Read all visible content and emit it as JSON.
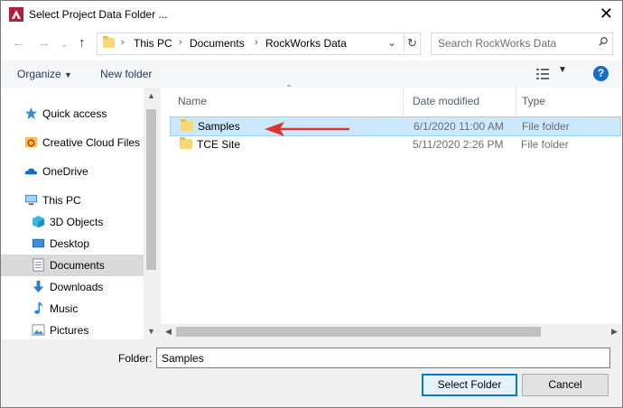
{
  "window": {
    "title": "Select Project Data Folder ..."
  },
  "address": {
    "crumbs": [
      "This PC",
      "Documents",
      "RockWorks Data"
    ],
    "search_placeholder": "Search RockWorks Data"
  },
  "toolbar": {
    "organize_label": "Organize",
    "new_folder_label": "New folder"
  },
  "sidebar": {
    "items": [
      {
        "label": "Quick access",
        "icon": "star-icon"
      },
      {
        "label": "Creative Cloud Files",
        "icon": "creative-cloud-icon"
      },
      {
        "label": "OneDrive",
        "icon": "cloud-icon"
      },
      {
        "label": "This PC",
        "icon": "computer-icon"
      },
      {
        "label": "3D Objects",
        "icon": "cube-icon"
      },
      {
        "label": "Desktop",
        "icon": "desktop-icon"
      },
      {
        "label": "Documents",
        "icon": "document-icon",
        "selected": true
      },
      {
        "label": "Downloads",
        "icon": "download-icon"
      },
      {
        "label": "Music",
        "icon": "music-icon"
      },
      {
        "label": "Pictures",
        "icon": "pictures-icon"
      }
    ]
  },
  "columns": {
    "name": "Name",
    "date": "Date modified",
    "type": "Type"
  },
  "files": [
    {
      "name": "Samples",
      "date": "6/1/2020 11:00 AM",
      "type": "File folder",
      "selected": true
    },
    {
      "name": "TCE Site",
      "date": "5/11/2020 2:26 PM",
      "type": "File folder"
    }
  ],
  "footer": {
    "folder_label": "Folder:",
    "folder_value": "Samples",
    "select_label": "Select Folder",
    "cancel_label": "Cancel"
  },
  "colors": {
    "accent": "#0078d7",
    "selection": "#cce8ff",
    "annotation_arrow": "#d9372b"
  }
}
